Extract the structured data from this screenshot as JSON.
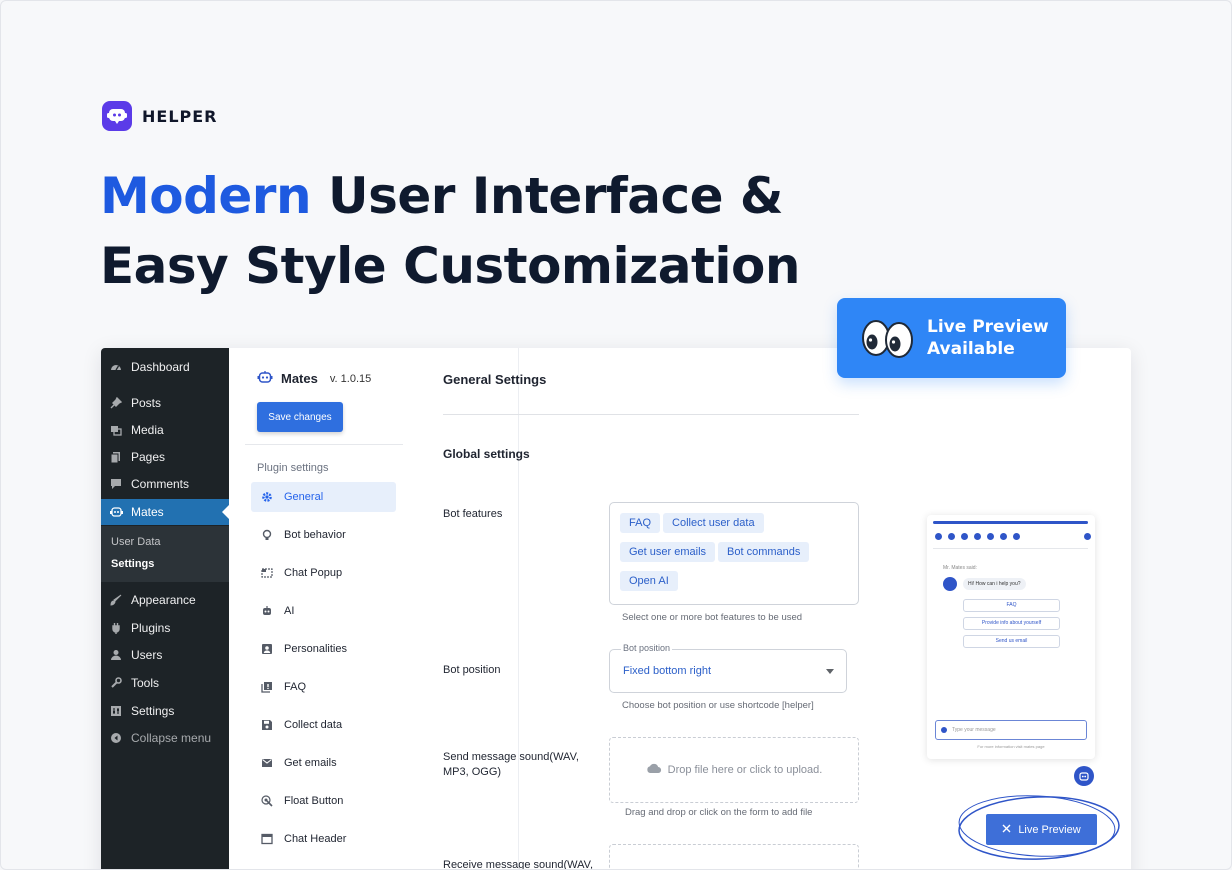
{
  "brand": {
    "name": "HELPER"
  },
  "headline": {
    "accent": "Modern",
    "line1_rest": " User Interface &",
    "line2": "Easy Style Customization"
  },
  "badge": {
    "line1": "Live Preview",
    "line2": "Available"
  },
  "wp_sidebar": {
    "items": [
      {
        "label": "Dashboard",
        "icon": "dashboard-icon"
      },
      {
        "label": "Posts",
        "icon": "pin-icon"
      },
      {
        "label": "Media",
        "icon": "media-icon"
      },
      {
        "label": "Pages",
        "icon": "pages-icon"
      },
      {
        "label": "Comments",
        "icon": "comment-icon"
      },
      {
        "label": "Mates",
        "icon": "robot-icon"
      },
      {
        "label": "Appearance",
        "icon": "brush-icon"
      },
      {
        "label": "Plugins",
        "icon": "plug-icon"
      },
      {
        "label": "Users",
        "icon": "user-icon"
      },
      {
        "label": "Tools",
        "icon": "wrench-icon"
      },
      {
        "label": "Settings",
        "icon": "settings-icon"
      }
    ],
    "sub": {
      "user_data": "User Data",
      "settings": "Settings"
    },
    "collapse": "Collapse menu"
  },
  "plugin": {
    "title": "Mates",
    "version": "v. 1.0.15",
    "save_label": "Save changes",
    "section_label": "Plugin settings",
    "nav": [
      {
        "label": "General",
        "icon": "gear-icon"
      },
      {
        "label": "Bot behavior",
        "icon": "lightbulb-icon"
      },
      {
        "label": "Chat Popup",
        "icon": "popup-icon"
      },
      {
        "label": "AI",
        "icon": "robot-icon"
      },
      {
        "label": "Personalities",
        "icon": "id-card-icon"
      },
      {
        "label": "FAQ",
        "icon": "faq-icon"
      },
      {
        "label": "Collect data",
        "icon": "save-icon"
      },
      {
        "label": "Get emails",
        "icon": "mail-icon"
      },
      {
        "label": "Float Button",
        "icon": "touch-icon"
      },
      {
        "label": "Chat Header",
        "icon": "window-icon"
      }
    ]
  },
  "settings": {
    "title": "General Settings",
    "global_title": "Global settings",
    "bot_features": {
      "label": "Bot features",
      "chips": [
        "FAQ",
        "Collect user data",
        "Get user emails",
        "Bot commands",
        "Open AI"
      ],
      "help": "Select one or more bot features to be used"
    },
    "bot_position": {
      "label": "Bot position",
      "float_label": "Bot position",
      "value": "Fixed bottom right",
      "help": "Choose bot position or use shortcode [helper]"
    },
    "send_sound": {
      "label": "Send message sound(WAV, MP3, OGG)",
      "drop_text": "Drop file here or click to upload.",
      "help": "Drag and drop or click on the form to add file"
    },
    "receive_sound": {
      "label": "Receive message sound(WAV,"
    }
  },
  "widget": {
    "who": "Mr. Mates said:",
    "greeting": "Hi! How can i help you?",
    "options": [
      "FAQ",
      "Provide info about yourself",
      "Send us email"
    ],
    "input_placeholder": "Type your message",
    "footer": "For more information visit mates page"
  },
  "live_preview_button": "Live Preview",
  "colors": {
    "accent_blue": "#1e5ae0",
    "wp_sidebar": "#1d2327",
    "wp_active": "#2271b1",
    "badge": "#2f86f6",
    "button_blue": "#2f6fdf"
  }
}
